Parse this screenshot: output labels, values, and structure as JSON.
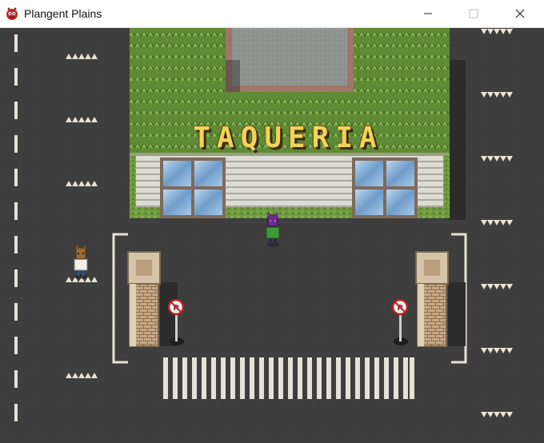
{
  "window": {
    "title": "Plangent Plains",
    "app_icon": "red-creature-icon",
    "controls": [
      "minimize-icon",
      "maximize-icon",
      "close-icon"
    ]
  },
  "scene": {
    "building_sign": "TAQUERIA",
    "no_parking_symbol": "P"
  }
}
